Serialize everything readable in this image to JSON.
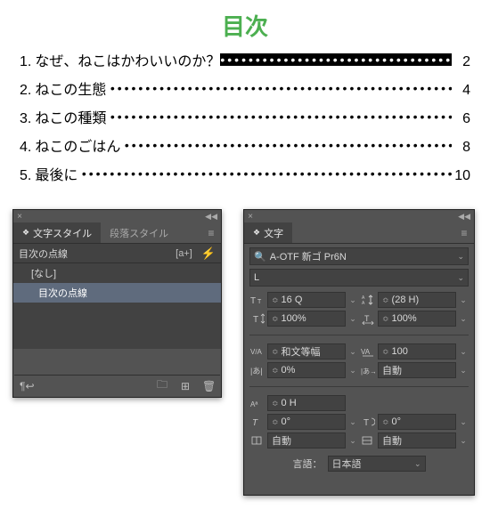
{
  "title": "目次",
  "toc": {
    "items": [
      {
        "num": "1.",
        "text": "なぜ、ねこはかわいいのか？",
        "page": "2",
        "highlight": true
      },
      {
        "num": "2.",
        "text": "ねこの生態",
        "page": "4"
      },
      {
        "num": "3.",
        "text": "ねこの種類",
        "page": "6"
      },
      {
        "num": "4.",
        "text": "ねこのごはん",
        "page": "8"
      },
      {
        "num": "5.",
        "text": "最後に",
        "page": "10"
      }
    ]
  },
  "panel_left": {
    "tabs": {
      "active": "文字スタイル",
      "inactive": "段落スタイル"
    },
    "subheader": "目次の点線",
    "items": {
      "none": "[なし]",
      "sel": "目次の点線"
    }
  },
  "panel_right": {
    "tab": "文字",
    "font_family": "A-OTF 新ゴ Pr6N",
    "font_weight": "L",
    "font_size": "16 Q",
    "leading": "(28 H)",
    "vscale": "100%",
    "hscale": "100%",
    "kerning": "和文等幅",
    "tracking": "100",
    "tsume": "0%",
    "aki_before": "自動",
    "baseline": "0 H",
    "skew": "0°",
    "rotate": "0°",
    "grid": "自動",
    "grid2": "自動",
    "language_label": "言語：",
    "language": "日本語"
  }
}
